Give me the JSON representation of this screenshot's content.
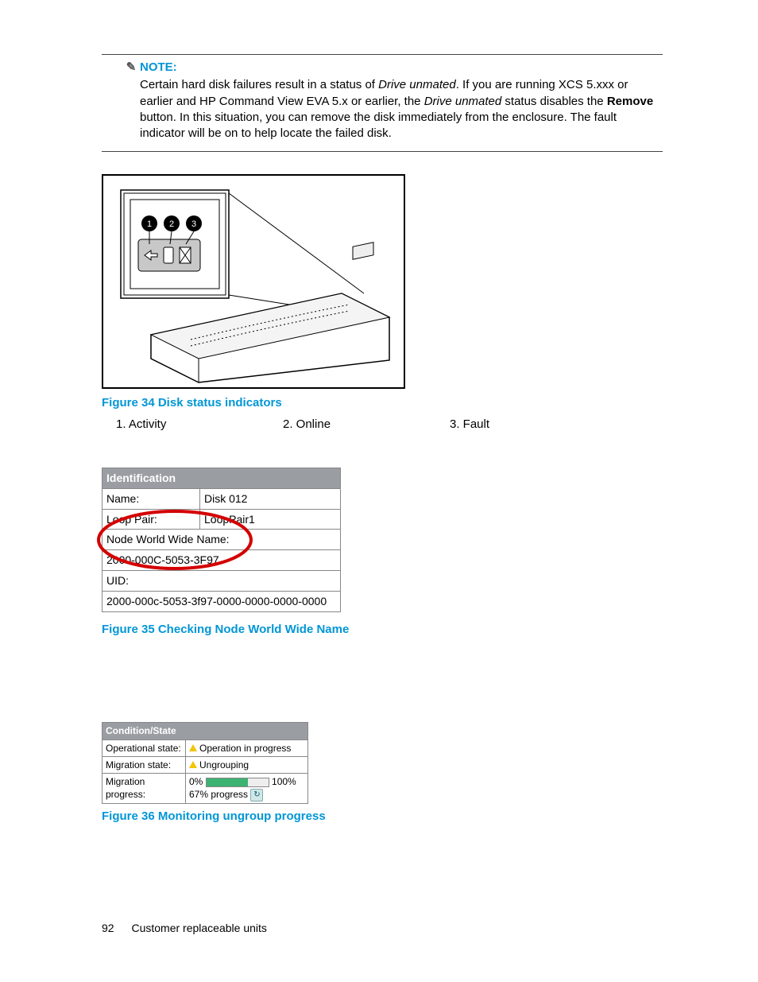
{
  "note": {
    "heading": "NOTE:",
    "body_pre": "Certain hard disk failures result in a status of ",
    "italic1": "Drive unmated",
    "body_mid1": ". If you are running XCS 5.xxx or earlier and HP Command View EVA 5.x or earlier, the ",
    "italic2": "Drive unmated",
    "body_mid2": " status disables the ",
    "bold1": "Remove",
    "body_post": " button. In this situation, you can remove the disk immediately from the enclosure. The fault indicator will be on to help locate the failed disk."
  },
  "figure34": {
    "caption": "Figure 34 Disk status indicators",
    "legend": [
      "1.  Activity",
      "2.  Online",
      "3.  Fault"
    ]
  },
  "figure35": {
    "caption": "Figure 35 Checking Node World Wide Name",
    "header": "Identification",
    "rows": {
      "name_label": "Name:",
      "name_value": "Disk 012",
      "loop_label": "Loop Pair:",
      "loop_value": "LoopPair1",
      "nwwn_label": "Node World Wide Name:",
      "nwwn_value": "2000-000C-5053-3F97",
      "uid_label": "UID:",
      "uid_value": "2000-000c-5053-3f97-0000-0000-0000-0000"
    }
  },
  "figure36": {
    "caption": "Figure 36 Monitoring ungroup progress",
    "header": "Condition/State",
    "rows": {
      "op_label": "Operational state:",
      "op_value": "Operation in progress",
      "mig_label": "Migration state:",
      "mig_value": "Ungrouping",
      "prog_label": "Migration progress:",
      "prog_0": "0%",
      "prog_100": "100%",
      "prog_text": "67% progress",
      "prog_percent": 67
    }
  },
  "footer": {
    "page": "92",
    "title": "Customer replaceable units"
  }
}
